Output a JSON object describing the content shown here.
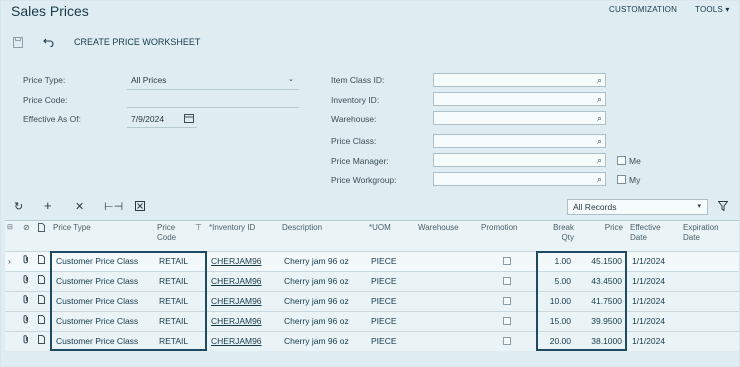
{
  "page": {
    "title": "Sales Prices",
    "customization": "CUSTOMIZATION",
    "tools": "TOOLS"
  },
  "toolbar": {
    "create_worksheet": "CREATE PRICE WORKSHEET"
  },
  "filters": {
    "price_type_label": "Price Type:",
    "price_type_value": "All Prices",
    "price_code_label": "Price Code:",
    "effective_label": "Effective As Of:",
    "effective_value": "7/9/2024",
    "item_class_label": "Item Class ID:",
    "inventory_label": "Inventory ID:",
    "warehouse_label": "Warehouse:",
    "price_class_label": "Price Class:",
    "price_manager_label": "Price Manager:",
    "price_workgroup_label": "Price Workgroup:",
    "me_label": "Me",
    "my_label": "My"
  },
  "grid_toolbar": {
    "records_select": "All Records"
  },
  "columns": {
    "price_type": "Price Type",
    "price_code_1": "Price",
    "price_code_2": "Code",
    "inventory_id": "*Inventory ID",
    "description": "Description",
    "uom": "*UOM",
    "warehouse": "Warehouse",
    "promotion": "Promotion",
    "break_qty_1": "Break",
    "break_qty_2": "Qty",
    "price": "Price",
    "eff_date_1": "Effective",
    "eff_date_2": "Date",
    "exp_date_1": "Expiration",
    "exp_date_2": "Date"
  },
  "rows": [
    {
      "price_type": "Customer Price Class",
      "price_code": "RETAIL",
      "inventory_id": "CHERJAM96",
      "description": "Cherry jam 96 oz",
      "uom": "PIECE",
      "break_qty": "1.00",
      "price": "45.1500",
      "effective_date": "1/1/2024"
    },
    {
      "price_type": "Customer Price Class",
      "price_code": "RETAIL",
      "inventory_id": "CHERJAM96",
      "description": "Cherry jam 96 oz",
      "uom": "PIECE",
      "break_qty": "5.00",
      "price": "43.4500",
      "effective_date": "1/1/2024"
    },
    {
      "price_type": "Customer Price Class",
      "price_code": "RETAIL",
      "inventory_id": "CHERJAM96",
      "description": "Cherry jam 96 oz",
      "uom": "PIECE",
      "break_qty": "10.00",
      "price": "41.7500",
      "effective_date": "1/1/2024"
    },
    {
      "price_type": "Customer Price Class",
      "price_code": "RETAIL",
      "inventory_id": "CHERJAM96",
      "description": "Cherry jam 96 oz",
      "uom": "PIECE",
      "break_qty": "15.00",
      "price": "39.9500",
      "effective_date": "1/1/2024"
    },
    {
      "price_type": "Customer Price Class",
      "price_code": "RETAIL",
      "inventory_id": "CHERJAM96",
      "description": "Cherry jam 96 oz",
      "uom": "PIECE",
      "break_qty": "20.00",
      "price": "38.1000",
      "effective_date": "1/1/2024"
    }
  ]
}
